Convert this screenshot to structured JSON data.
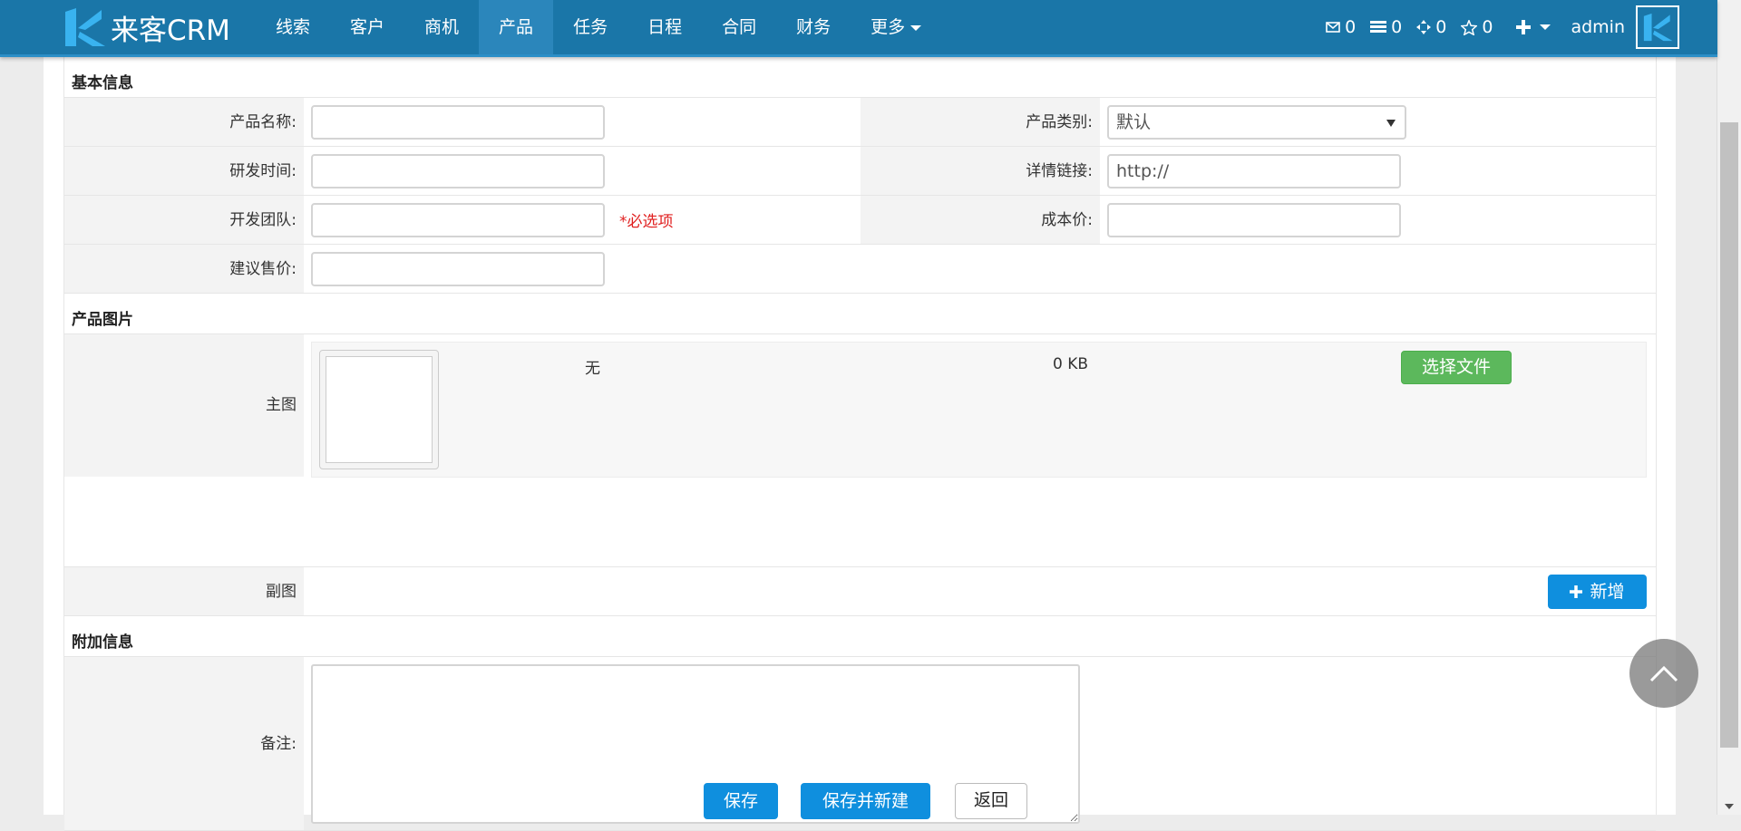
{
  "app": {
    "logo_text": "来客CRM"
  },
  "nav": {
    "items": [
      {
        "label": "线索"
      },
      {
        "label": "客户"
      },
      {
        "label": "商机"
      },
      {
        "label": "产品",
        "active": true
      },
      {
        "label": "任务"
      },
      {
        "label": "日程"
      },
      {
        "label": "合同"
      },
      {
        "label": "财务"
      },
      {
        "label": "更多"
      }
    ]
  },
  "header_right": {
    "mail_count": "0",
    "list_count": "0",
    "cross_count": "0",
    "star_count": "0",
    "username": "admin"
  },
  "sections": {
    "basic": "基本信息",
    "images": "产品图片",
    "extra": "附加信息"
  },
  "fields": {
    "name_label": "产品名称:",
    "name_value": "",
    "category_label": "产品类别:",
    "category_value": "默认",
    "dev_time_label": "研发时间:",
    "dev_time_value": "",
    "link_label": "详情链接:",
    "link_placeholder": "http://",
    "team_label": "开发团队:",
    "team_value": "",
    "team_required": "*必选项",
    "cost_label": "成本价:",
    "cost_value": "",
    "price_label": "建议售价:",
    "price_value": "",
    "main_image_label": "主图",
    "main_image_name": "无",
    "main_image_size": "0 KB",
    "choose_file": "选择文件",
    "sub_image_label": "副图",
    "add_button": "新增",
    "remark_label": "备注:"
  },
  "actions": {
    "save": "保存",
    "save_new": "保存并新建",
    "back": "返回"
  },
  "colors": {
    "nav_bg": "#1a76a8",
    "active_nav": "#2b86bb",
    "success": "#5cb85c",
    "primary": "#0f8fde",
    "required": "#e02020"
  }
}
